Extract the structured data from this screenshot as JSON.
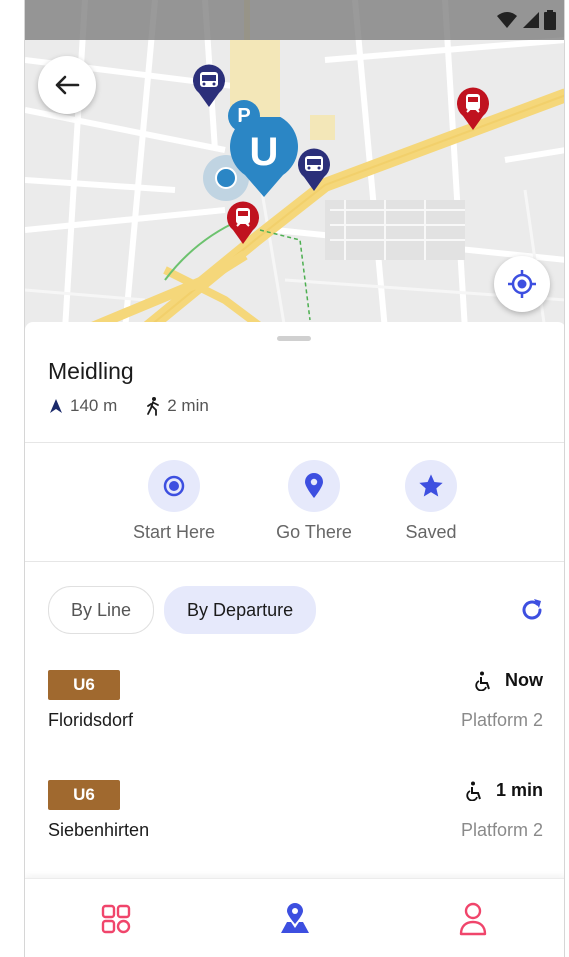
{
  "stop": {
    "name": "Meidling",
    "distance": "140 m",
    "walk_time": "2 min"
  },
  "actions": [
    {
      "label": "Start Here",
      "icon": "radio-target-icon"
    },
    {
      "label": "Go There",
      "icon": "location-pin-icon"
    },
    {
      "label": "Saved",
      "icon": "star-icon"
    }
  ],
  "tabs": {
    "by_line": "By Line",
    "by_departure": "By Departure",
    "active": "By Departure"
  },
  "departures": [
    {
      "line": "U6",
      "destination": "Floridsdorf",
      "time": "Now",
      "platform": "Platform 2",
      "accessible": true
    },
    {
      "line": "U6",
      "destination": "Siebenhirten",
      "time": "1 min",
      "platform": "Platform 2",
      "accessible": true
    }
  ],
  "map": {
    "station_marker_letter": "U",
    "parking_marker_letter": "P"
  },
  "colors": {
    "accent": "#3d4fe0",
    "line_u6": "#a0692f",
    "station_marker": "#2b86c5",
    "bus_marker": "#2b2f7a",
    "train_marker": "#c0121f",
    "nav_pink": "#f0456b"
  },
  "nav": [
    {
      "name": "dashboard",
      "icon": "grid-icon"
    },
    {
      "name": "map",
      "icon": "map-pin-icon"
    },
    {
      "name": "profile",
      "icon": "person-icon"
    }
  ]
}
